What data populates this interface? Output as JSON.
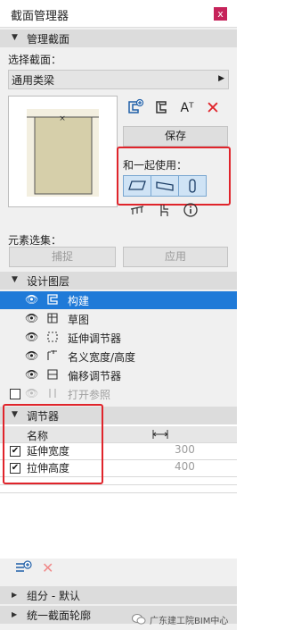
{
  "window": {
    "title": "截面管理器",
    "close_label": "x"
  },
  "manage": {
    "header": "管理截面",
    "select_label": "选择截面：",
    "selected_profile": "通用类梁",
    "save_label": "保存",
    "use_with_label": "和一起使用：",
    "text_icon": "Aᵀ"
  },
  "element_set": {
    "label": "元素选集：",
    "capture_label": "捕捉",
    "apply_label": "应用"
  },
  "design_layers": {
    "header": "设计图层",
    "items": [
      {
        "label": "构建",
        "selected": true
      },
      {
        "label": "草图",
        "selected": false
      },
      {
        "label": "延伸调节器",
        "selected": false
      },
      {
        "label": "名义宽度/高度",
        "selected": false
      },
      {
        "label": "偏移调节器",
        "selected": false
      },
      {
        "label": "打开参照",
        "selected": false,
        "disabled": true
      }
    ]
  },
  "adjusters": {
    "header": "调节器",
    "col_name": "名称",
    "col_icon": "width-arrows-icon",
    "rows": [
      {
        "name": "延伸宽度",
        "value": "300",
        "checked": true
      },
      {
        "name": "拉伸高度",
        "value": "400",
        "checked": true
      }
    ]
  },
  "footer_sections": [
    {
      "label": "组分 - 默认"
    },
    {
      "label": "统一截面轮廓"
    }
  ],
  "watermark": "广东建工院BIM中心",
  "colors": {
    "highlight": "#e0242b",
    "selection": "#1f7ad8",
    "close_button": "#c6235a"
  }
}
